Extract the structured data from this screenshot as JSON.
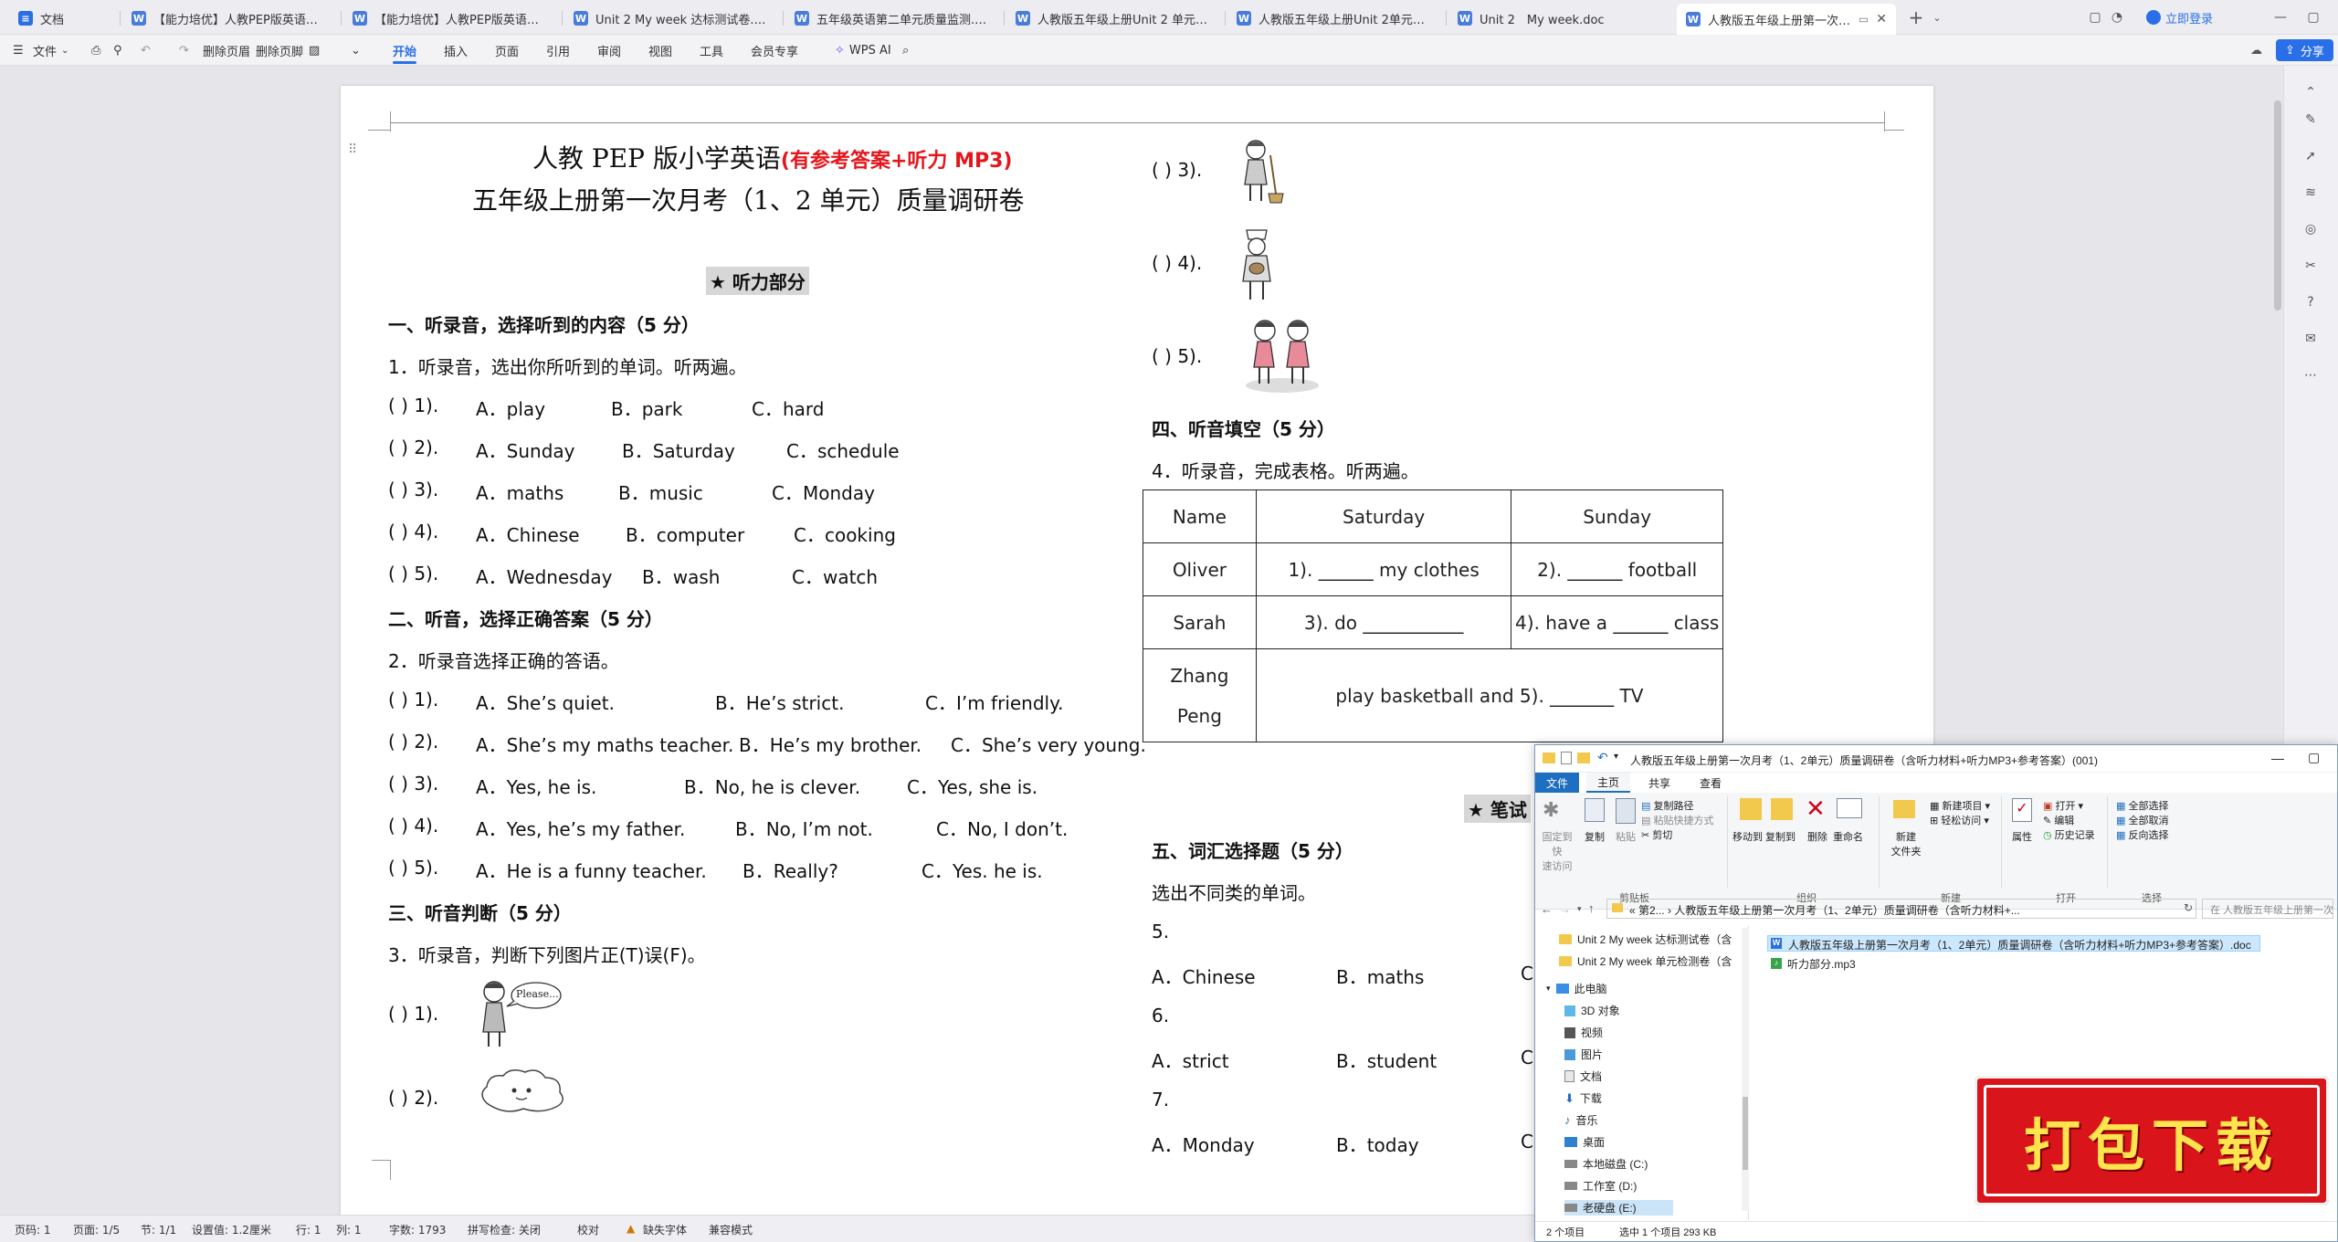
{
  "tabs": [
    {
      "label": "文档",
      "icon": "docs-app-icon"
    },
    {
      "label": "【能力培优】人教PEP版英语五年级上...",
      "icon": "word-doc-icon"
    },
    {
      "label": "【能力培优】人教PEP版英语五年级上...",
      "icon": "word-doc-icon"
    },
    {
      "label": "Unit 2 My week 达标测试卷.doc",
      "icon": "word-doc-icon"
    },
    {
      "label": "五年级英语第二单元质量监测.doc",
      "icon": "word-doc-icon"
    },
    {
      "label": "人教版五年级上册Unit 2 单元质量调...",
      "icon": "word-doc-icon"
    },
    {
      "label": "人教版五年级上册Unit 2单元质量调研...",
      "icon": "word-doc-icon"
    },
    {
      "label": "Unit 2　My week.doc",
      "icon": "word-doc-icon"
    },
    {
      "label": "人教版五年级上册第一次月考",
      "icon": "word-doc-icon",
      "active": true
    }
  ],
  "titlebar": {
    "login": "立即登录"
  },
  "ribbon": {
    "file": "文件",
    "delete_header": "删除页眉",
    "delete_footer": "删除页脚",
    "tabs": [
      "开始",
      "插入",
      "页面",
      "引用",
      "审阅",
      "视图",
      "工具",
      "会员专享"
    ],
    "wps_ai": "WPS AI",
    "share": "分享"
  },
  "doc": {
    "title1": "人教 PEP 版小学英语",
    "title1_red": "(有参考答案+听力 MP3)",
    "title2": "五年级上册第一次月考（1、2 单元）质量调研卷",
    "listening_header": "★  听力部分",
    "s1": {
      "heading": "一、听录音，选择听到的内容（5 分）",
      "instr": "1．听录音，选出你所听到的单词。听两遍。",
      "items": [
        {
          "n": "(        ) 1).",
          "a": "A．play",
          "b": "B．park",
          "c": "C．hard"
        },
        {
          "n": "(        ) 2).",
          "a": "A．Sunday",
          "b": "B．Saturday",
          "c": "C．schedule"
        },
        {
          "n": "(        ) 3).",
          "a": "A．maths",
          "b": "B．music",
          "c": "C．Monday"
        },
        {
          "n": "(        ) 4).",
          "a": "A．Chinese",
          "b": "B．computer",
          "c": "C．cooking"
        },
        {
          "n": "(        ) 5).",
          "a": "A．Wednesday",
          "b": "B．wash",
          "c": "C．watch"
        }
      ]
    },
    "s2": {
      "heading": "二、听音，选择正确答案（5 分）",
      "instr": "2．听录音选择正确的答语。",
      "items": [
        {
          "n": "(        ) 1).",
          "a": "A．She’s quiet.",
          "b": "B．He’s strict.",
          "c": "C．I’m friendly."
        },
        {
          "n": "(        ) 2).",
          "a": "A．She’s my maths teacher.",
          "b": "B．He’s my brother.",
          "c": "C．She’s very young."
        },
        {
          "n": "(        ) 3).",
          "a": "A．Yes, he is.",
          "b": "B．No, he is clever.",
          "c": "C．Yes, she is."
        },
        {
          "n": "(        ) 4).",
          "a": "A．Yes, he’s my father.",
          "b": "B．No, I’m not.",
          "c": "C．No, I don’t."
        },
        {
          "n": "(        ) 5).",
          "a": "A．He is a funny teacher.",
          "b": "B．Really?",
          "c": "C．Yes. he is."
        }
      ]
    },
    "s3": {
      "heading": "三、听音判断（5 分）",
      "instr": "3．听录音，判断下列图片正(T)误(F)。",
      "items": [
        "(        ) 1).",
        "(        ) 2).",
        "(        ) 3).",
        "(        ) 4).",
        "(        ) 5)."
      ],
      "bubble": "Please..."
    },
    "s4": {
      "heading": "四、听音填空（5 分）",
      "instr": "4．听录音，完成表格。听两遍。",
      "table": {
        "headers": [
          "Name",
          "Saturday",
          "Sunday"
        ],
        "rows": [
          {
            "name": "Oliver",
            "sat": "1). ______ my clothes",
            "sun": "2). ______ football"
          },
          {
            "name": "Sarah",
            "sat": "3). do ___________",
            "sun": "4). have a ______ class"
          }
        ],
        "last_name_1": "Zhang",
        "last_name_2": "Peng",
        "last_text": "play basketball and 5). _______ TV"
      }
    },
    "written_header": "★  笔试",
    "s5": {
      "heading": "五、词汇选择题（5 分）",
      "instr": "选出不同类的单词。",
      "items": [
        {
          "n": "5.",
          "a": "A．Chinese",
          "b": "B．maths",
          "c": "C"
        },
        {
          "n": "6.",
          "a": "A．strict",
          "b": "B．student",
          "c": "C"
        },
        {
          "n": "7.",
          "a": "A．Monday",
          "b": "B．today",
          "c": "C"
        }
      ]
    }
  },
  "status": {
    "page_num": "页码: 1",
    "pages": "页面: 1/5",
    "section": "节: 1/1",
    "setting": "设置值: 1.2厘米",
    "row": "行: 1",
    "col": "列: 1",
    "words": "字数: 1793",
    "spell": "拼写检查: 关闭",
    "proof": "校对",
    "missing_font": "缺失字体",
    "compat": "兼容模式"
  },
  "explorer": {
    "title": "人教版五年级上册第一次月考（1、2单元）质量调研卷（含听力材料+听力MP3+参考答案）(001)",
    "tabs": [
      "文件",
      "主页",
      "共享",
      "查看"
    ],
    "ribbon": {
      "pin": "固定到快\n速访问",
      "copy": "复制",
      "paste": "粘贴",
      "copy_path": "复制路径",
      "paste_shortcut": "粘贴快捷方式",
      "cut": "剪切",
      "clipboard": "剪贴板",
      "move_to": "移动到",
      "copy_to": "复制到",
      "delete": "删除",
      "rename": "重命名",
      "organize": "组织",
      "new_folder": "新建\n文件夹",
      "new_item": "新建项目",
      "easy_access": "轻松访问",
      "new": "新建",
      "properties": "属性",
      "open": "打开",
      "edit": "编辑",
      "history": "历史记录",
      "open_group": "打开",
      "select_all": "全部选择",
      "select_none": "全部取消",
      "invert": "反向选择",
      "select": "选择"
    },
    "breadcrumb": "«  第2...  ›  人教版五年级上册第一次月考（1、2单元）质量调研卷（含听力材料+...",
    "search_placeholder": "在 人教版五年级上册第一次月考（1...",
    "tree": [
      {
        "label": "Unit 2 My week 达标测试卷（含",
        "icon": "folder-icon"
      },
      {
        "label": "Unit 2 My week 单元检测卷（含",
        "icon": "folder-icon"
      },
      {
        "label": "此电脑",
        "icon": "computer-icon"
      },
      {
        "label": "3D 对象",
        "icon": "3d-objects-icon"
      },
      {
        "label": "视频",
        "icon": "video-icon"
      },
      {
        "label": "图片",
        "icon": "pictures-icon"
      },
      {
        "label": "文档",
        "icon": "documents-icon"
      },
      {
        "label": "下载",
        "icon": "download-icon"
      },
      {
        "label": "音乐",
        "icon": "music-icon"
      },
      {
        "label": "桌面",
        "icon": "desktop-icon"
      },
      {
        "label": "本地磁盘 (C:)",
        "icon": "disk-icon"
      },
      {
        "label": "工作室 (D:)",
        "icon": "disk-icon"
      },
      {
        "label": "老硬盘 (E:)",
        "icon": "disk-icon"
      }
    ],
    "files": [
      {
        "name": "人教版五年级上册第一次月考（1、2单元）质量调研卷（含听力材料+听力MP3+参考答案）.doc",
        "selected": true
      },
      {
        "name": "听力部分.mp3",
        "selected": false
      }
    ],
    "status_items": "2 个项目",
    "status_selected": "选中 1 个项目  293 KB"
  },
  "stamp": {
    "text": "打包下载"
  }
}
